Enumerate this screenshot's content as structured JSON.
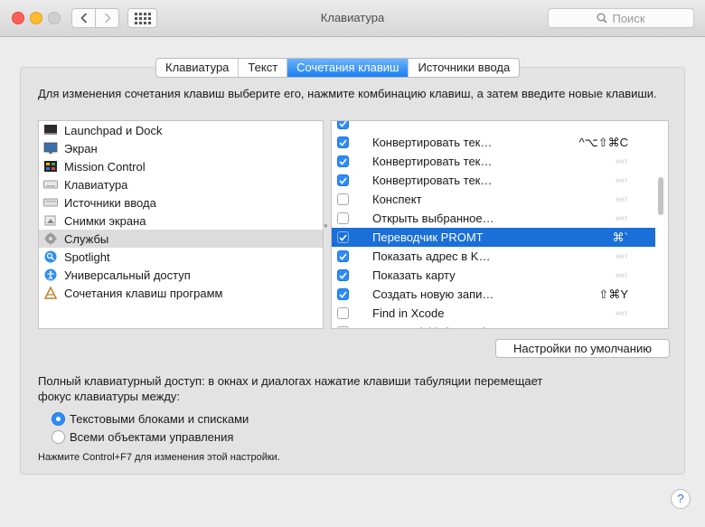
{
  "window": {
    "title": "Клавиатура"
  },
  "search": {
    "placeholder": "Поиск"
  },
  "tabs": [
    {
      "label": "Клавиатура",
      "selected": false
    },
    {
      "label": "Текст",
      "selected": false
    },
    {
      "label": "Сочетания клавиш",
      "selected": true
    },
    {
      "label": "Источники ввода",
      "selected": false
    }
  ],
  "description": "Для изменения сочетания клавиш выберите его, нажмите комбинацию клавиш, а затем введите новые клавиши.",
  "categories": [
    {
      "label": "Launchpad и Dock",
      "icon": "launchpad-dock-icon",
      "selected": false
    },
    {
      "label": "Экран",
      "icon": "display-icon",
      "selected": false
    },
    {
      "label": "Mission Control",
      "icon": "mission-control-icon",
      "selected": false
    },
    {
      "label": "Клавиатура",
      "icon": "keyboard-icon",
      "selected": false
    },
    {
      "label": "Источники ввода",
      "icon": "input-sources-icon",
      "selected": false
    },
    {
      "label": "Снимки экрана",
      "icon": "screenshot-icon",
      "selected": false
    },
    {
      "label": "Службы",
      "icon": "services-gear-icon",
      "selected": true
    },
    {
      "label": "Spotlight",
      "icon": "spotlight-icon",
      "selected": false
    },
    {
      "label": "Универсальный доступ",
      "icon": "accessibility-icon",
      "selected": false
    },
    {
      "label": "Сочетания клавиш программ",
      "icon": "app-shortcuts-icon",
      "selected": false
    }
  ],
  "shortcuts": [
    {
      "name": "",
      "checked": true,
      "key": ""
    },
    {
      "name": "Конвертировать тек…",
      "checked": true,
      "key": "^⌥⇧⌘C"
    },
    {
      "name": "Конвертировать тек…",
      "checked": true,
      "key": "нет"
    },
    {
      "name": "Конвертировать тек…",
      "checked": true,
      "key": "нет"
    },
    {
      "name": "Конспект",
      "checked": false,
      "key": "нет"
    },
    {
      "name": "Открыть выбранное…",
      "checked": false,
      "key": "нет"
    },
    {
      "name": "Переводчик PROMT",
      "checked": true,
      "key": "⌘`",
      "selected": true
    },
    {
      "name": "Показать адрес в K…",
      "checked": true,
      "key": "нет"
    },
    {
      "name": "Показать карту",
      "checked": true,
      "key": "нет"
    },
    {
      "name": "Создать новую запи…",
      "checked": true,
      "key": "⇧⌘Y"
    },
    {
      "name": "Find in Xcode",
      "checked": false,
      "key": "нет"
    },
    {
      "name": "Open Quickly in Xcode",
      "checked": false,
      "key": "нет"
    }
  ],
  "restore_defaults_label": "Настройки по умолчанию",
  "full_keyboard_access": {
    "label": "Полный клавиатурный доступ: в окнах и диалогах нажатие клавиши табуляции перемещает фокус клавиатуры между:",
    "options": [
      {
        "label": "Текстовыми блоками и списками",
        "selected": true
      },
      {
        "label": "Всеми объектами управления",
        "selected": false
      }
    ],
    "hint": "Нажмите Control+F7 для изменения этой настройки."
  },
  "help_label": "?"
}
